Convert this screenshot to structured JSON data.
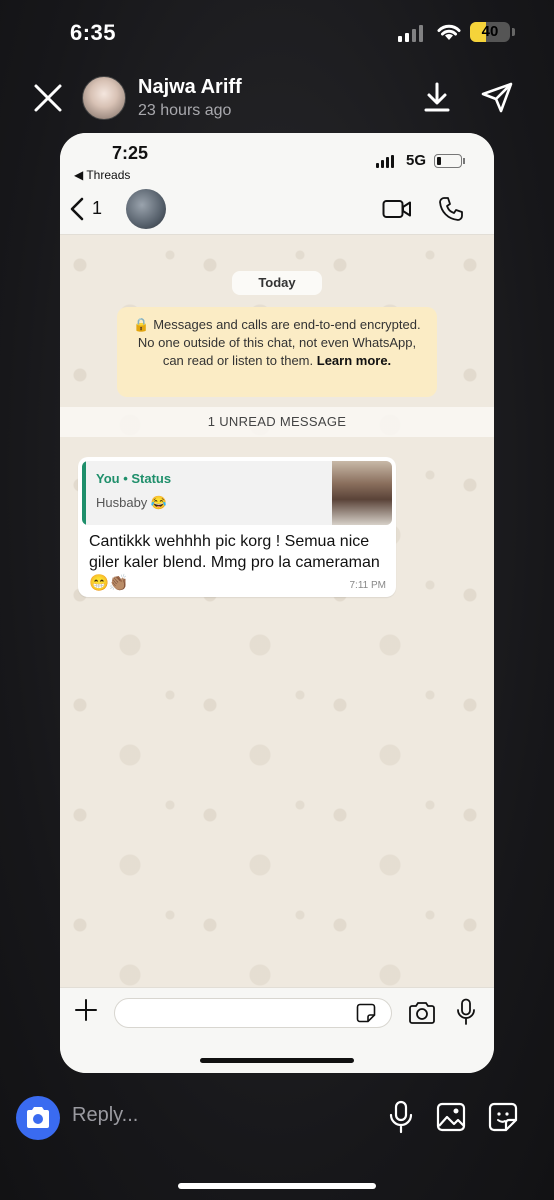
{
  "os_status": {
    "time": "6:35",
    "battery": "40"
  },
  "story": {
    "sender_name": "Najwa Ariff",
    "posted": "23 hours ago"
  },
  "screenshot": {
    "status": {
      "time": "7:25",
      "back_app": "◀ Threads",
      "network": "5G"
    },
    "chat_header": {
      "unread_count": "1"
    },
    "date_label": "Today",
    "encryption_notice": "Messages and calls are end-to-end encrypted. No one outside of this chat, not even WhatsApp, can read or listen to them.",
    "encryption_link": "Learn more.",
    "unread_divider": "1 UNREAD MESSAGE",
    "message": {
      "quote_author": "You • Status",
      "quote_text": "Husbaby 😂",
      "text": "Cantikkk wehhhh pic korg ! Semua nice giler kaler blend. Mmg pro la cameraman 😁👏🏽",
      "time": "7:11 PM"
    }
  },
  "reply": {
    "placeholder": "Reply..."
  },
  "colors": {
    "accent_green": "#1f8f6b",
    "encryption_bg": "#fbecc5",
    "reply_camera": "#3a6bf0",
    "battery_yellow": "#f5d33a"
  }
}
